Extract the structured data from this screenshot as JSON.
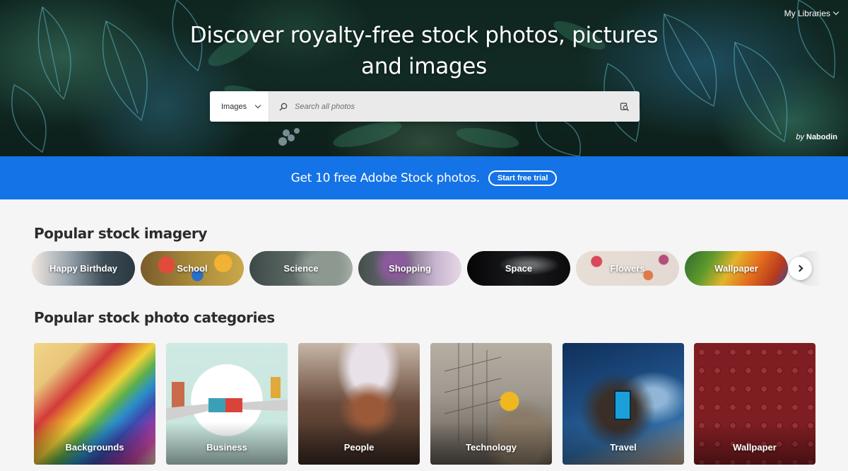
{
  "header": {
    "title": "Discover royalty-free stock photos, pictures and images",
    "my_libraries": "My Libraries",
    "credit_by": "by",
    "credit_name": "Nabodin"
  },
  "search": {
    "type_label": "Images",
    "placeholder": "Search all photos"
  },
  "promo": {
    "text": "Get 10 free Adobe Stock photos.",
    "button": "Start free trial"
  },
  "popular_imagery": {
    "title": "Popular stock imagery",
    "items": [
      {
        "label": "Happy Birthday"
      },
      {
        "label": "School"
      },
      {
        "label": "Science"
      },
      {
        "label": "Shopping"
      },
      {
        "label": "Space"
      },
      {
        "label": "Flowers"
      },
      {
        "label": "Wallpaper"
      }
    ]
  },
  "categories": {
    "title": "Popular stock photo categories",
    "items": [
      {
        "label": "Backgrounds"
      },
      {
        "label": "Business"
      },
      {
        "label": "People"
      },
      {
        "label": "Technology"
      },
      {
        "label": "Travel"
      },
      {
        "label": "Wallpaper"
      }
    ]
  },
  "colors": {
    "promo_blue": "#1473e6",
    "page_bg": "#f5f5f5",
    "heading_text": "#2c2c2c"
  },
  "icons": [
    "chevron-down-icon",
    "search-icon",
    "visual-search-icon",
    "chevron-right-icon"
  ]
}
